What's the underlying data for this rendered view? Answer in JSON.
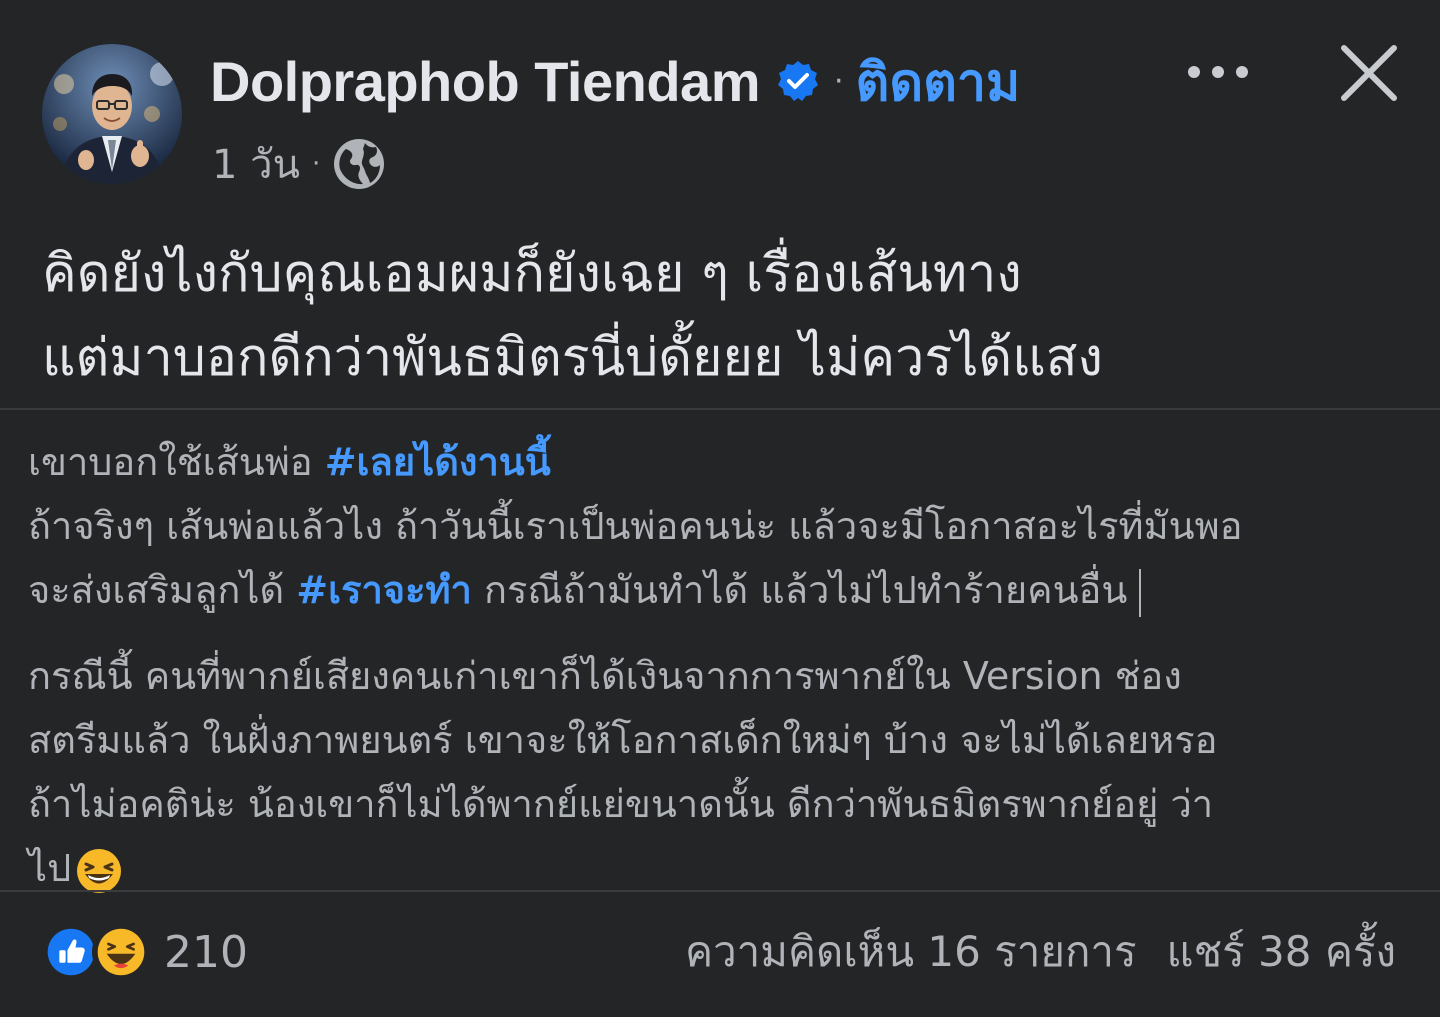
{
  "post": {
    "author": "Dolpraphob Tiendam",
    "verified_icon": "verified-badge-icon",
    "separator": "·",
    "follow_label": "ติดตาม",
    "time": "1 วัน",
    "meta_separator": "·",
    "privacy_icon": "globe-icon",
    "text_lines": [
      "คิดยังไงกับคุณเอมผมก็ยังเฉย ๆ เรื่องเส้นทาง",
      "แต่มาบอกดีกว่าพันธมิตรนี่บ่ดั้ยยย ไม่ควรได้แสง"
    ]
  },
  "shared": {
    "line1_prefix": "เขาบอกใช้เส้นพ่อ ",
    "hashtag1": "#เลยได้งานนี้",
    "line2": "ถ้าจริงๆ เส้นพ่อแล้วไง ถ้าวันนี้เราเป็นพ่อคนน่ะ แล้วจะมีโอกาสอะไรที่มันพอ",
    "line3_prefix": "จะส่งเสริมลูกได้ ",
    "hashtag2": "#เราจะทำ",
    "line3_suffix": " กรณีถ้ามันทำได้ แล้วไม่ไปทำร้ายคนอื่น",
    "para2_lines": [
      "กรณีนี้ คนที่พากย์เสียงคนเก่าเขาก็ได้เงินจากการพากย์ใน Version ช่อง",
      "สตรีมแล้ว ในฝั่งภาพยนตร์ เขาจะให้โอกาสเด็กใหม่ๆ บ้าง จะไม่ได้เลยหรอ",
      "ถ้าไม่อคติน่ะ น้องเขาก็ไม่ได้พากย์แย่ขนาดนั้น ดีกว่าพันธมิตรพากย์อยู่ ว่า"
    ],
    "last_line": "ไป",
    "emoji": "laughing-emoji"
  },
  "footer": {
    "reaction_icons": [
      "like-reaction-icon",
      "haha-reaction-icon"
    ],
    "reaction_count": "210",
    "comments": "ความคิดเห็น 16 รายการ",
    "shares": "แชร์ 38 ครั้ง"
  },
  "colors": {
    "background": "#242526",
    "text_primary": "#e4e6eb",
    "text_secondary": "#b0b3b8",
    "link": "#4599ff",
    "like_blue": "#1877f2",
    "haha_yellow": "#f7b928"
  }
}
